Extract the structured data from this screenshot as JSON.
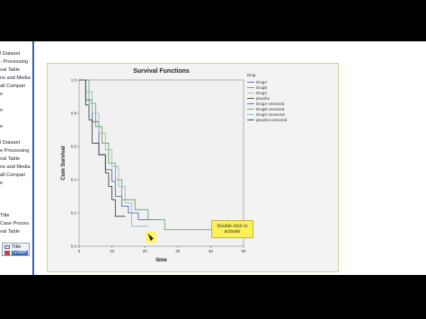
{
  "nav": {
    "items": [
      "",
      "l Dataset",
      "- Processing",
      "val Table",
      "ns and Media",
      "all Compari",
      "e",
      "",
      "n",
      "",
      "e",
      "",
      "l Dataset",
      "e Processing",
      "val Table",
      "ns and Media",
      "all Compari",
      "e",
      "",
      "",
      "",
      "Title",
      "Case Proces",
      "val Table"
    ],
    "selected": {
      "title": "Title",
      "label": "Graph"
    }
  },
  "chart_data": {
    "type": "line",
    "title": "Survival Functions",
    "xlabel": "time",
    "ylabel": "Cum Survival",
    "xlim": [
      0,
      50
    ],
    "ylim": [
      0,
      1.0
    ],
    "xticks": [
      "0",
      "10",
      "20",
      "30",
      "40",
      "50"
    ],
    "yticks": [
      "0.0",
      "0.2",
      "0.4",
      "0.6",
      "0.8",
      "1.0"
    ],
    "legend_title": "Drug",
    "legend_position": "right",
    "legend": [
      "DrugA",
      "DrugB",
      "DrugC",
      "placebo",
      "DrugA-censored",
      "DrugB-censored",
      "DrugC-censored",
      "placebo-censored"
    ],
    "series": [
      {
        "name": "DrugA",
        "color": "#3b5ba8",
        "points": [
          [
            0,
            1.0
          ],
          [
            2,
            0.88
          ],
          [
            4,
            0.75
          ],
          [
            6,
            0.55
          ],
          [
            8,
            0.46
          ],
          [
            10,
            0.39
          ],
          [
            11,
            0.3
          ],
          [
            13,
            0.24
          ],
          [
            15,
            0.2
          ],
          [
            18,
            0.16
          ],
          [
            25,
            0.16
          ]
        ]
      },
      {
        "name": "DrugB",
        "color": "#59a05a",
        "points": [
          [
            0,
            1.0
          ],
          [
            3,
            0.86
          ],
          [
            5,
            0.72
          ],
          [
            7,
            0.62
          ],
          [
            9,
            0.5
          ],
          [
            11,
            0.4
          ],
          [
            13,
            0.28
          ],
          [
            17,
            0.22
          ],
          [
            21,
            0.16
          ],
          [
            26,
            0.1
          ],
          [
            48,
            0.1
          ]
        ]
      },
      {
        "name": "DrugC",
        "color": "#8db3c9",
        "points": [
          [
            0,
            1.0
          ],
          [
            2,
            0.93
          ],
          [
            4,
            0.8
          ],
          [
            6,
            0.68
          ],
          [
            8,
            0.58
          ],
          [
            10,
            0.48
          ],
          [
            12,
            0.36
          ],
          [
            14,
            0.26
          ],
          [
            16,
            0.12
          ],
          [
            21,
            0.12
          ]
        ]
      },
      {
        "name": "placebo",
        "color": "#333333",
        "points": [
          [
            0,
            1.0
          ],
          [
            2,
            0.85
          ],
          [
            3,
            0.76
          ],
          [
            4,
            0.62
          ],
          [
            6,
            0.55
          ],
          [
            8,
            0.44
          ],
          [
            9,
            0.36
          ],
          [
            10,
            0.28
          ],
          [
            11,
            0.18
          ],
          [
            14,
            0.18
          ]
        ]
      }
    ]
  },
  "activate_button": {
    "line1": "Double-click to",
    "line2": "activate"
  },
  "colors": {
    "nav_border": "#3f63a8",
    "chart_background": "#f3f3f3",
    "activate_background": "#fbf25a"
  }
}
